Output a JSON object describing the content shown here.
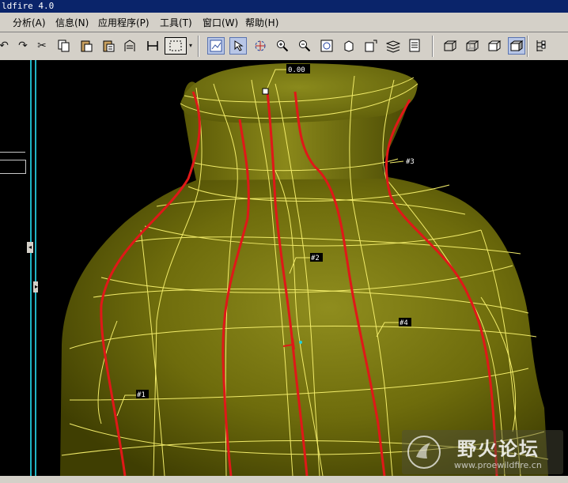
{
  "window": {
    "title": "ldfire 4.0"
  },
  "menu": {
    "items": [
      {
        "name": "menu-analysis",
        "label": "分析(A)"
      },
      {
        "name": "menu-info",
        "label": "信息(N)"
      },
      {
        "name": "menu-applications",
        "label": "应用程序(P)"
      },
      {
        "name": "menu-tools",
        "label": "工具(T)"
      },
      {
        "name": "menu-window",
        "label": "窗口(W)"
      },
      {
        "name": "menu-help",
        "label": "帮助(H)"
      }
    ]
  },
  "toolbar": {
    "icons": [
      "undo-icon",
      "redo-icon",
      "cut-icon",
      "copy-icon",
      "paste-icon",
      "paste-special-icon",
      "regenerate-icon",
      "regen-manager-icon",
      "selection-box-icon",
      "repaint-icon",
      "orient-mode-icon",
      "spin-center-icon",
      "zoom-in-icon",
      "zoom-out-icon",
      "refit-icon",
      "reorient-icon",
      "saved-views-icon",
      "layers-icon",
      "view-manager-icon",
      "wireframe-icon",
      "hidden-line-icon",
      "no-hidden-icon",
      "shading-icon",
      "model-tree-icon"
    ]
  },
  "viewport": {
    "dimensions": [
      {
        "name": "dimension-label-top",
        "text": "0.00"
      },
      {
        "name": "dimension-label-3",
        "text": "#3"
      },
      {
        "name": "dimension-label-2",
        "text": "#2"
      },
      {
        "name": "dimension-label-4",
        "text": "#4"
      },
      {
        "name": "dimension-label-1",
        "text": "#1"
      }
    ],
    "colors": {
      "background": "#000000",
      "surface": "#7a7a10",
      "wire": "#f2ec6a",
      "curve": "#e01818"
    }
  },
  "watermark": {
    "title": "野火论坛",
    "url": "www.proewildfire.cn"
  }
}
